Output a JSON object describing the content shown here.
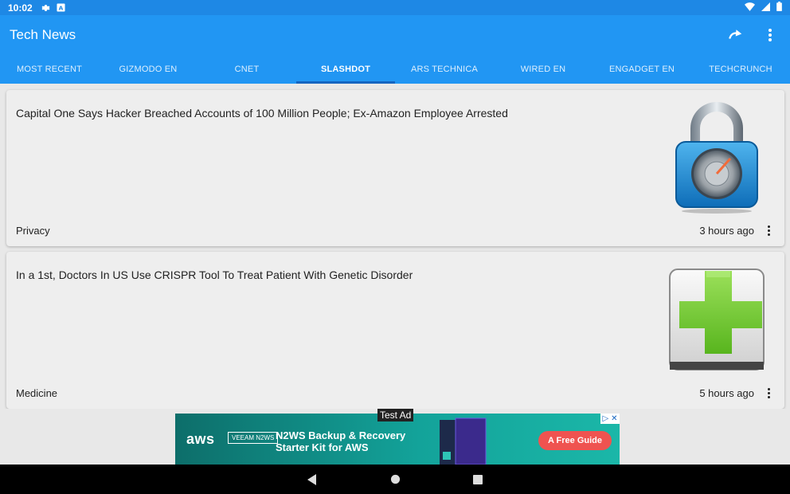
{
  "status_bar": {
    "time": "10:02"
  },
  "app": {
    "title": "Tech News",
    "accent": "#2196f3",
    "status_color": "#1e88e5"
  },
  "tabs": [
    {
      "label": "MOST RECENT"
    },
    {
      "label": "GIZMODO EN"
    },
    {
      "label": "CNET"
    },
    {
      "label": "SLASHDOT",
      "active": true
    },
    {
      "label": "ARS TECHNICA"
    },
    {
      "label": "WIRED EN"
    },
    {
      "label": "ENGADGET EN"
    },
    {
      "label": "TECHCRUNCH"
    }
  ],
  "articles": [
    {
      "title": "Capital One Says Hacker Breached Accounts of 100 Million People; Ex-Amazon Employee Arrested",
      "tag": "Privacy",
      "time": "3 hours ago",
      "thumbnail": "padlock-icon"
    },
    {
      "title": "In a 1st, Doctors In US Use CRISPR Tool To Treat Patient With Genetic Disorder",
      "tag": "Medicine",
      "time": "5 hours ago",
      "thumbnail": "medical-cross-icon"
    }
  ],
  "ad": {
    "label": "Test Ad",
    "brand": "aws",
    "partner": "VEEAM N2WS",
    "headline_line1": "N2WS Backup & Recovery",
    "headline_line2": "Starter Kit for AWS",
    "cta": "A Free Guide"
  }
}
